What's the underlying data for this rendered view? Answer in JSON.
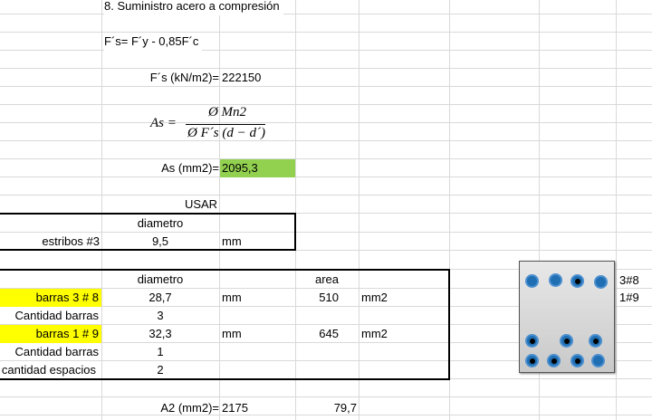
{
  "title": "8. Suministro acero a compresión",
  "fs_formula": "F´s= F´y - 0,85F´c",
  "fs_label": "F´s (kN/m2)=",
  "fs_value": "222150",
  "as_formula": {
    "lhs": "As =",
    "numerator": "Ø Mn2",
    "denominator": "Ø F´s (d − d´)"
  },
  "as_label": "As  (mm2)=",
  "as_value": "2095,3",
  "usar": "USAR",
  "estribos_table": {
    "header": "diametro",
    "row_label": "estribos #3",
    "value": "9,5",
    "unit": "mm"
  },
  "bars_table": {
    "headers": {
      "diametro": "diametro",
      "area": "area"
    },
    "rows": [
      {
        "label": "barras  3 # 8",
        "diametro": "28,7",
        "unit1": "mm",
        "area": "510",
        "unit2": "mm2"
      },
      {
        "label": "Cantidad barras",
        "diametro": "3"
      },
      {
        "label": "barras  1 # 9",
        "diametro": "32,3",
        "unit1": "mm",
        "area": "645",
        "unit2": "mm2"
      },
      {
        "label": "Cantidad barras",
        "diametro": "1"
      },
      {
        "label": "cantidad espacios",
        "diametro": "2"
      }
    ]
  },
  "a2_label": "A2 (mm2)=",
  "a2_value": "2175",
  "a2_extra": "79,7",
  "section_labels": [
    "3#8",
    "1#9"
  ],
  "colors": {
    "highlight_yellow": "#ffff00",
    "highlight_green": "#92d050",
    "rebar_blue": "#1f6fb2"
  }
}
